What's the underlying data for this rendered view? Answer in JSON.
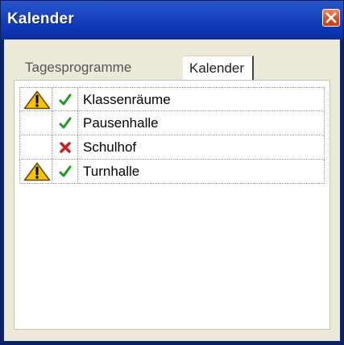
{
  "window": {
    "title": "Kalender"
  },
  "tabs": [
    {
      "label": "Tagesprogramme",
      "active": false
    },
    {
      "label": "Kalender",
      "active": true
    }
  ],
  "rooms": [
    {
      "name": "Klassenräume",
      "warning": true,
      "status": "ok"
    },
    {
      "name": "Pausenhalle",
      "warning": false,
      "status": "ok"
    },
    {
      "name": "Schulhof",
      "warning": false,
      "status": "error"
    },
    {
      "name": "Turnhalle",
      "warning": true,
      "status": "ok"
    }
  ],
  "colors": {
    "titlebar": "#1845c0",
    "ok": "#1e9a1e",
    "error": "#d01a1a",
    "warning": "#f5c400"
  },
  "icons": {
    "warning": "warning-triangle-icon",
    "ok": "checkmark-icon",
    "error": "cross-icon",
    "close": "close-icon"
  }
}
